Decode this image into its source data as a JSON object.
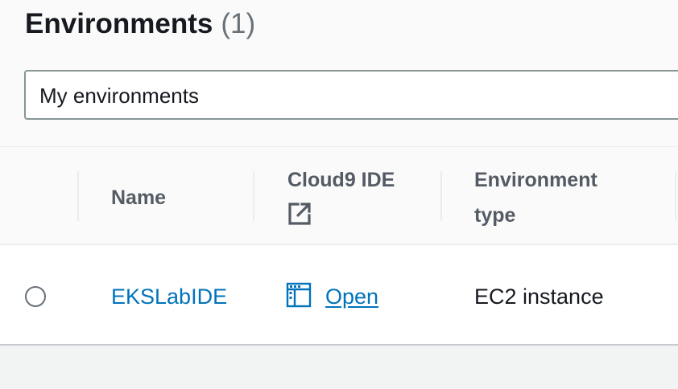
{
  "header": {
    "title": "Environments",
    "count": "(1)"
  },
  "filter": {
    "selected": "My environments"
  },
  "table": {
    "columns": {
      "name": "Name",
      "cloud9_ide": "Cloud9 IDE",
      "env_type_line1": "Environment",
      "env_type_line2": "type"
    },
    "rows": [
      {
        "name": "EKSLabIDE",
        "open_label": "Open",
        "environment_type": "EC2 instance"
      }
    ]
  },
  "colors": {
    "link": "#0073bb",
    "heading": "#16191f",
    "column_header": "#545b64",
    "muted": "#687078"
  },
  "icons": {
    "external_link": "external-link-icon",
    "ide": "ide-window-icon"
  }
}
